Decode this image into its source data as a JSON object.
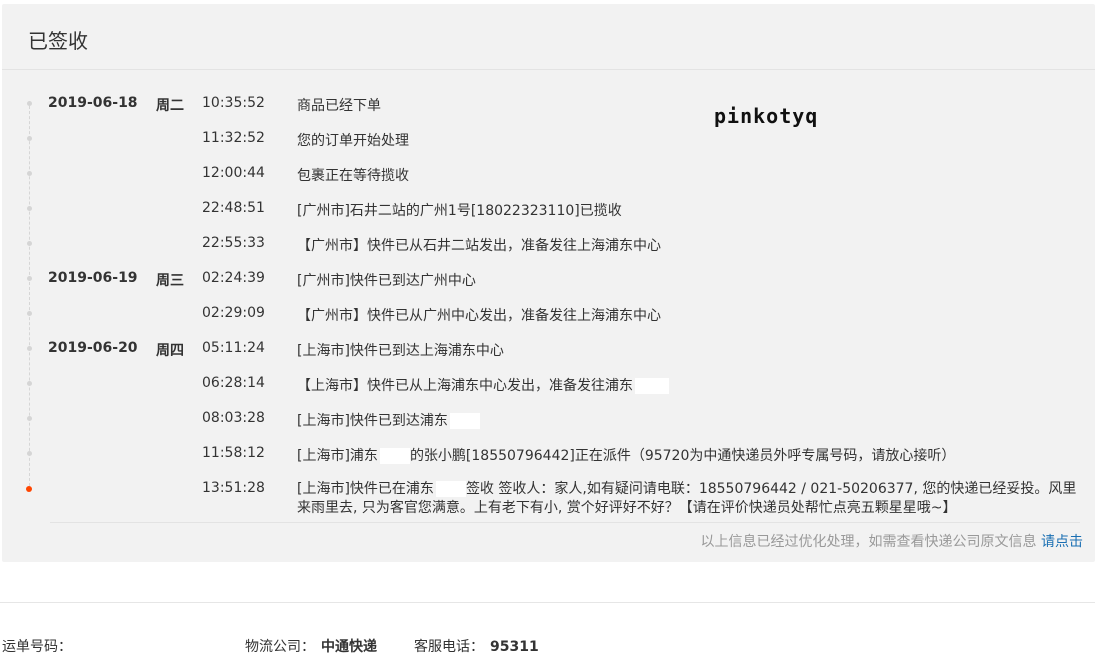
{
  "panel": {
    "title": "已签收"
  },
  "watermark": "pinkotyq",
  "events": [
    {
      "date": "2019-06-18",
      "week": "周二",
      "time": "10:35:52",
      "msg": "商品已经下单"
    },
    {
      "date": "",
      "week": "",
      "time": "11:32:52",
      "msg": "您的订单开始处理"
    },
    {
      "date": "",
      "week": "",
      "time": "12:00:44",
      "msg": "包裹正在等待揽收"
    },
    {
      "date": "",
      "week": "",
      "time": "22:48:51",
      "msg": "[广州市]石井二站的广州1号[18022323110]已揽收"
    },
    {
      "date": "",
      "week": "",
      "time": "22:55:33",
      "msg": "【广州市】快件已从石井二站发出，准备发往上海浦东中心"
    },
    {
      "date": "2019-06-19",
      "week": "周三",
      "time": "02:24:39",
      "msg": "[广州市]快件已到达广州中心"
    },
    {
      "date": "",
      "week": "",
      "time": "02:29:09",
      "msg": "【广州市】快件已从广州中心发出，准备发往上海浦东中心"
    },
    {
      "date": "2019-06-20",
      "week": "周四",
      "time": "05:11:24",
      "msg": "[上海市]快件已到达上海浦东中心"
    },
    {
      "date": "",
      "week": "",
      "time": "06:28:14",
      "msg": "【上海市】快件已从上海浦东中心发出，准备发往浦东"
    },
    {
      "date": "",
      "week": "",
      "time": "08:03:28",
      "msg": "[上海市]快件已到达浦东"
    },
    {
      "date": "",
      "week": "",
      "time": "11:58:12",
      "msg_a": "[上海市]浦东",
      "msg_b": "的张小鹏[18550796442]正在派件（95720为中通快递员外呼专属号码，请放心接听）"
    },
    {
      "date": "",
      "week": "",
      "time": "13:51:28",
      "msg_a": "[上海市]快件已在浦东",
      "msg_b": "签收 签收人：家人,如有疑问请电联：18550796442 / 021-50206377, 您的快递已经妥投。风里来雨里去, 只为客官您满意。上有老下有小, 赏个好评好不好？【请在评价快递员处帮忙点亮五颗星星哦~】"
    }
  ],
  "note": {
    "text": "以上信息已经过优化处理，如需查看快递公司原文信息",
    "link": "请点击"
  },
  "footer": {
    "waybill_label": "运单号码：",
    "company_label": "物流公司：",
    "company": "中通快递",
    "phone_label": "客服电话：",
    "phone": "95311"
  },
  "colors": {
    "panel_bg": "#f2f2f2",
    "last_dot": "#ff4500",
    "link": "#1a6fb3"
  }
}
